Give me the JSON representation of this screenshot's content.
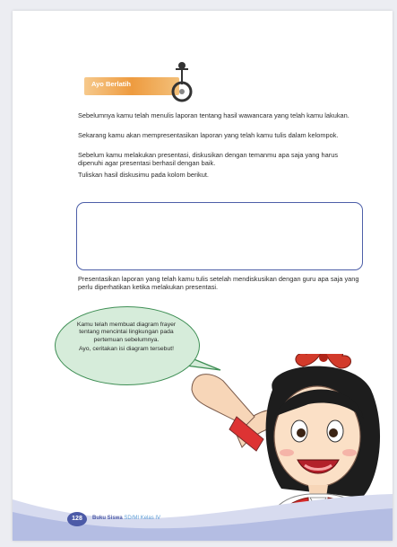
{
  "banner": {
    "label": "Ayo Berlatih"
  },
  "paragraphs": [
    "Sebelumnya kamu telah menulis laporan tentang hasil wawancara yang telah kamu lakukan.",
    "Sekarang kamu akan mempresentasikan laporan yang telah kamu tulis dalam kelompok.",
    "Sebelum kamu melakukan presentasi, diskusikan dengan temanmu apa saja yang harus dipenuhi agar presentasi berhasil dengan baik.",
    "Tuliskan hasil diskusimu pada kolom berikut."
  ],
  "after_box": "Presentasikan laporan yang telah kamu tulis setelah mendiskusikan dengan guru apa saja yang perlu diperhatikan ketika melakukan presentasi.",
  "bubble": {
    "line1": "Kamu telah membuat diagram frayer tentang mencintai lingkungan pada pertemuan sebelumnya.",
    "line2": "Ayo, ceritakan isi diagram tersebut!"
  },
  "footer": {
    "page_number": "128",
    "book": "Buku Siswa",
    "level": "SD/MI Kelas IV"
  },
  "colors": {
    "accent_blue": "#4c5aa7",
    "bubble_green": "#d6ecda",
    "banner_orange": "#ee9b3f"
  }
}
